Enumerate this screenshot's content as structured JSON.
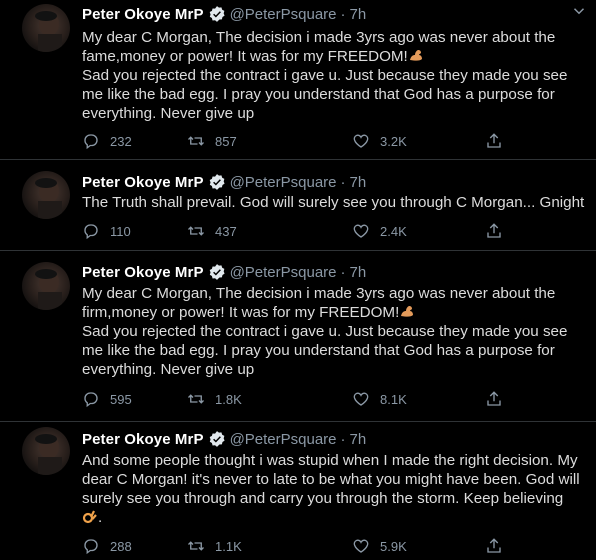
{
  "colors": {
    "background": "#000000",
    "text": "#dcdcdc",
    "name": "#ffffff",
    "muted": "#8b98a5",
    "verified": "#1d9bf0",
    "divider": "#2f3336"
  },
  "tweets": [
    {
      "author_name": "Peter Okoye MrP",
      "handle": "@PeterPsquare",
      "separator": "·",
      "time": "7h",
      "verified_icon": "verified-badge-icon",
      "text_before_emoji": "My dear C Morgan, The decision i made 3yrs ago was never about the fame,money or power! It was for my FREEDOM!",
      "emoji": "flexed-biceps-emoji",
      "text_after_emoji": "\nSad you rejected the contract i gave u. Just because they made you see me like the bad egg. I pray you understand that God has a purpose for everything. Never give up",
      "replies": "232",
      "retweets": "857",
      "likes": "3.2K"
    },
    {
      "author_name": "Peter Okoye MrP",
      "handle": "@PeterPsquare",
      "separator": "·",
      "time": "7h",
      "verified_icon": "verified-badge-icon",
      "text_before_emoji": "The Truth shall prevail. God will surely see you through C Morgan... Gnight",
      "emoji": "",
      "text_after_emoji": "",
      "replies": "110",
      "retweets": "437",
      "likes": "2.4K"
    },
    {
      "author_name": "Peter Okoye MrP",
      "handle": "@PeterPsquare",
      "separator": "·",
      "time": "7h",
      "verified_icon": "verified-badge-icon",
      "text_before_emoji": "My dear C Morgan, The decision i made 3yrs ago was never about the firm,money or power! It was for my FREEDOM!",
      "emoji": "flexed-biceps-emoji",
      "text_after_emoji": "\nSad you rejected the contract i gave u. Just because they made you see me like the bad egg. I pray you understand that God has a purpose for everything. Never give up",
      "replies": "595",
      "retweets": "1.8K",
      "likes": "8.1K"
    },
    {
      "author_name": "Peter Okoye MrP",
      "handle": "@PeterPsquare",
      "separator": "·",
      "time": "7h",
      "verified_icon": "verified-badge-icon",
      "text_before_emoji": "And some people thought i was stupid when I made the right decision. My dear C Morgan! it's never to late to be what you might have been. God will surely see you through and carry you through the storm. Keep believing\n",
      "emoji": "ok-hand-emoji",
      "text_after_emoji": ".",
      "replies": "288",
      "retweets": "1.1K",
      "likes": "5.9K"
    }
  ]
}
